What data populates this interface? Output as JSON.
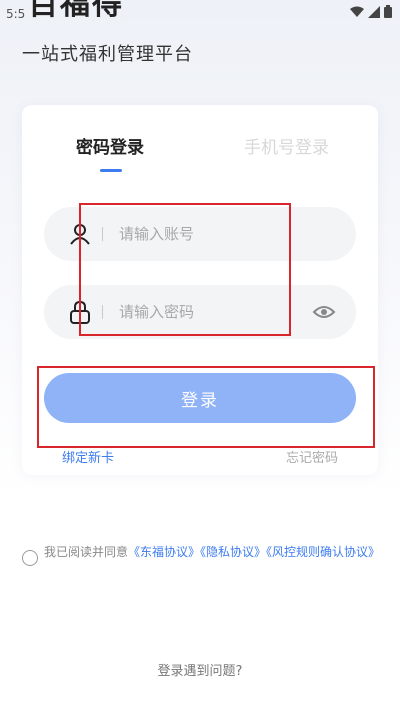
{
  "status_bar": {
    "time": "5:5"
  },
  "app": {
    "title": "百福得",
    "subtitle": "一站式福利管理平台"
  },
  "tabs": {
    "password_login": "密码登录",
    "phone_login": "手机号登录"
  },
  "account_field": {
    "placeholder": "请输入账号",
    "value": ""
  },
  "password_field": {
    "placeholder": "请输入密码",
    "value": ""
  },
  "login_button": {
    "label": "登录"
  },
  "links": {
    "bind_card": "绑定新卡",
    "forgot_password": "忘记密码"
  },
  "agreement": {
    "prefix": "我已阅读并同意",
    "doc1": "《东福协议》",
    "doc2": "《隐私协议》",
    "doc3": "《风控规则确认协议》",
    "checked": false
  },
  "help": {
    "label": "登录遇到问题?"
  },
  "colors": {
    "accent": "#3d7cf0",
    "button": "#8fb3f6",
    "highlight": "#d9262c"
  }
}
